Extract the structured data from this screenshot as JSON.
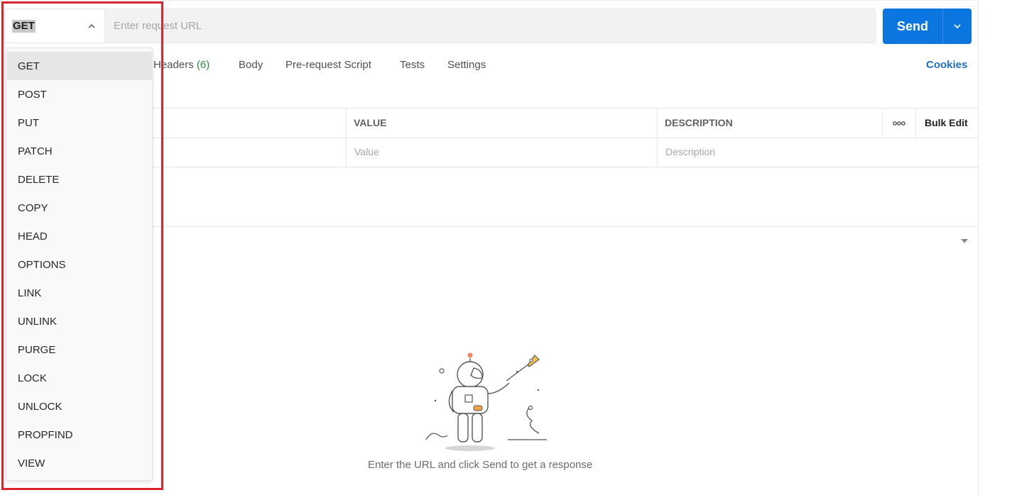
{
  "request": {
    "method": "GET",
    "url_placeholder": "Enter request URL",
    "send_label": "Send"
  },
  "tabs": [
    {
      "label": "Headers",
      "count": "(6)"
    },
    {
      "label": "Body"
    },
    {
      "label": "Pre-request Script"
    },
    {
      "label": "Tests"
    },
    {
      "label": "Settings"
    }
  ],
  "cookies_label": "Cookies",
  "params_table": {
    "headers": [
      "VALUE",
      "DESCRIPTION"
    ],
    "bulk_edit_label": "Bulk Edit",
    "value_placeholder": "Value",
    "description_placeholder": "Description"
  },
  "response": {
    "empty_message": "Enter the URL and click Send to get a response"
  },
  "method_dropdown": {
    "selected": "GET",
    "options": [
      "GET",
      "POST",
      "PUT",
      "PATCH",
      "DELETE",
      "COPY",
      "HEAD",
      "OPTIONS",
      "LINK",
      "UNLINK",
      "PURGE",
      "LOCK",
      "UNLOCK",
      "PROPFIND",
      "VIEW"
    ]
  },
  "colors": {
    "accent": "#0b75e0",
    "link": "#1f6fc2",
    "count_green": "#2f8a3e",
    "highlight_red": "#d9262e"
  },
  "icons": [
    "chevron-up-icon",
    "chevron-down-icon",
    "more-horizontal-icon",
    "caret-down-icon",
    "astronaut-illustration"
  ]
}
